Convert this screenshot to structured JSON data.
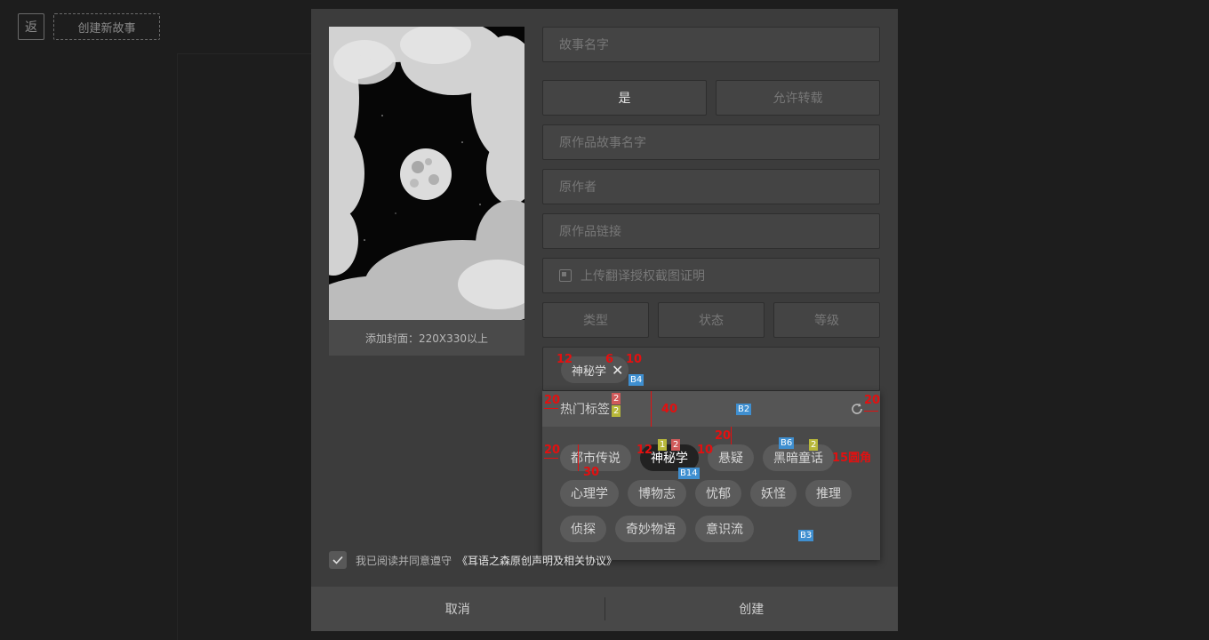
{
  "background": {
    "back_button": "返",
    "create_story_button": "创建新故事"
  },
  "cover": {
    "caption": "添加封面：220X330以上"
  },
  "form": {
    "story_name_placeholder": "故事名字",
    "is_repost_value": "是",
    "allow_repost_label": "允许转载",
    "original_story_name_placeholder": "原作品故事名字",
    "original_author_placeholder": "原作者",
    "original_link_placeholder": "原作品链接",
    "upload_proof_label": "上传翻译授权截图证明",
    "type_select": "类型",
    "status_select": "状态",
    "level_select": "等级"
  },
  "tags": {
    "selected": [
      {
        "label": "神秘学"
      }
    ],
    "dropdown_title": "热门标签",
    "items": [
      {
        "label": "都市传说",
        "active": false
      },
      {
        "label": "神秘学",
        "active": true
      },
      {
        "label": "悬疑",
        "active": false
      },
      {
        "label": "黑暗童话",
        "active": false
      },
      {
        "label": "心理学",
        "active": false
      },
      {
        "label": "博物志",
        "active": false
      },
      {
        "label": "忧郁",
        "active": false
      },
      {
        "label": "妖怪",
        "active": false
      },
      {
        "label": "推理",
        "active": false
      },
      {
        "label": "侦探",
        "active": false
      },
      {
        "label": "奇妙物语",
        "active": false
      },
      {
        "label": "意识流",
        "active": false
      }
    ]
  },
  "agreement": {
    "text": "我已阅读并同意遵守",
    "link": "《耳语之森原创声明及相关协议》"
  },
  "footer": {
    "cancel": "取消",
    "create": "创建"
  },
  "annotations": {
    "pad12a": "12",
    "gap6": "6",
    "pad10a": "10",
    "b4": "B4",
    "pad20a": "20",
    "n2a": "2",
    "n2b": "2",
    "h40": "40",
    "b2": "B2",
    "pad20b": "20",
    "pad20c": "20",
    "w30": "30",
    "pad12b": "12",
    "n1": "1",
    "n2c": "2",
    "gap10": "10",
    "gap20": "20",
    "b6": "B6",
    "n2d": "2",
    "radius15": "15圆角",
    "b14": "B14",
    "b3": "B3"
  }
}
